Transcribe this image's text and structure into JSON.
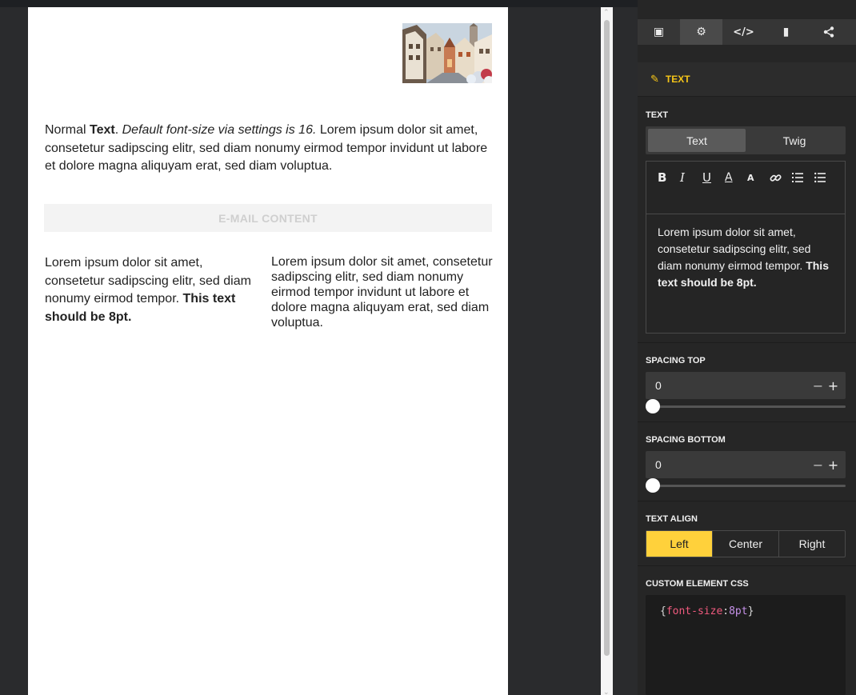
{
  "canvas": {
    "intro": {
      "normal": "Normal ",
      "bold": "Text",
      "dot": ". ",
      "italic": "Default font-size via settings is 16.",
      "rest": " Lorem ipsum dolor sit amet, consetetur sadipscing elitr, sed diam nonumy eirmod tempor invidunt ut labore et dolore magna aliquyam erat, sed diam voluptua."
    },
    "email_content_label": "E-MAIL CONTENT",
    "left_col": {
      "text": "Lorem ipsum dolor sit amet, consetetur sadipscing elitr, sed diam nonumy eirmod tempor. ",
      "bold": "This text should be 8pt."
    },
    "right_col": "Lorem ipsum dolor sit amet, consetetur sadipscing elitr, sed diam nonumy eirmod tempor invidunt ut labore et dolore magna aliquyam erat, sed diam voluptua."
  },
  "panel": {
    "toolbar": [
      {
        "icon": "layout-icon",
        "glyph": "▣"
      },
      {
        "icon": "gear-icon",
        "glyph": "⚙"
      },
      {
        "icon": "code-icon",
        "glyph": "</>"
      },
      {
        "icon": "mobile-icon",
        "glyph": "▮"
      },
      {
        "icon": "share-icon",
        "glyph": "⋖"
      }
    ],
    "section_title": "TEXT",
    "text_label": "TEXT",
    "text_mode": {
      "options": [
        "Text",
        "Twig"
      ],
      "selected": "Text"
    },
    "editor_buttons": [
      "B",
      "I",
      "U",
      "A",
      "A",
      "🔗",
      "≔",
      "☰"
    ],
    "editor_content": {
      "text": "Lorem ipsum dolor sit amet, consetetur sadipscing elitr, sed diam nonumy eirmod tempor. ",
      "bold": "This text should be 8pt."
    },
    "spacing_top": {
      "label": "SPACING TOP",
      "value": "0",
      "minus": "−",
      "plus": "+",
      "slider_fraction": 0
    },
    "spacing_bottom": {
      "label": "SPACING BOTTOM",
      "value": "0",
      "minus": "−",
      "plus": "+",
      "slider_fraction": 0
    },
    "text_align": {
      "label": "TEXT ALIGN",
      "options": [
        "Left",
        "Center",
        "Right"
      ],
      "selected": "Left"
    },
    "custom_css": {
      "label": "CUSTOM ELEMENT CSS",
      "open": "{",
      "prop": "font-size",
      "colon": ":",
      "value": "8pt",
      "close": "}"
    },
    "colors": {
      "accent": "#ffd13b",
      "panel_bg": "#262626"
    }
  }
}
